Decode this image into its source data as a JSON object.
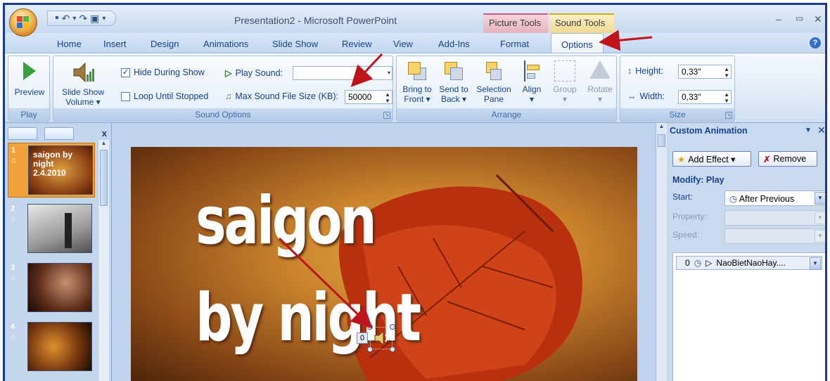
{
  "window": {
    "title": "Presentation2 - Microsoft PowerPoint",
    "context_tools": [
      "Picture Tools",
      "Sound Tools"
    ],
    "controls": [
      "–",
      "▭",
      "✕"
    ]
  },
  "qat": {
    "save": "▪",
    "undo": "↶",
    "undo_drop": "▾",
    "redo": "↷",
    "view": "▣",
    "more": "▾"
  },
  "tabs": [
    "Home",
    "Insert",
    "Design",
    "Animations",
    "Slide Show",
    "Review",
    "View",
    "Add-Ins",
    "Format",
    "Options"
  ],
  "active_tab": "Options",
  "ribbon": {
    "play": {
      "preview": "Preview",
      "group": "Play"
    },
    "sound_options": {
      "volume_line1": "Slide Show",
      "volume_line2": "Volume ▾",
      "hide_during_show": "Hide During Show",
      "hide_checked": "✓",
      "loop_until_stopped": "Loop Until Stopped",
      "play_sound": "Play Sound:",
      "play_sound_value": "",
      "max_size": "Max Sound File Size (KB):",
      "max_size_value": "50000",
      "group": "Sound Options"
    },
    "arrange": {
      "bring_l1": "Bring to",
      "bring_l2": "Front ▾",
      "send_l1": "Send to",
      "send_l2": "Back ▾",
      "selection_l1": "Selection",
      "selection_l2": "Pane",
      "align_l1": "Align",
      "align_l2": "▾",
      "group_l1": "Group",
      "group_l2": "▾",
      "rotate_l1": "Rotate",
      "rotate_l2": "▾",
      "group": "Arrange"
    },
    "size": {
      "height": "Height:",
      "height_value": "0,33\"",
      "width": "Width:",
      "width_value": "0,33\"",
      "group": "Size"
    }
  },
  "slides_panel": {
    "slides": [
      {
        "num": "1",
        "text": "saigon by night 2.4.2010"
      },
      {
        "num": "2"
      },
      {
        "num": "3"
      },
      {
        "num": "4"
      }
    ],
    "close": "x"
  },
  "slide": {
    "line1": "saigon",
    "line2": "by night",
    "sound_badge": "0"
  },
  "custom_animation": {
    "title": "Custom Animation",
    "add_effect": "Add Effect ▾",
    "remove": "Remove",
    "modify": "Modify: Play",
    "start_label": "Start:",
    "start_value": "After Previous",
    "property_label": "Property:",
    "speed_label": "Speed:",
    "list_item_index": "0",
    "list_item_name": "NaoBietNaoHay...."
  },
  "colors": {
    "accent_arrow": "#c0141c",
    "ribbon_text": "#15428b",
    "frame": "#1a3a8f"
  }
}
